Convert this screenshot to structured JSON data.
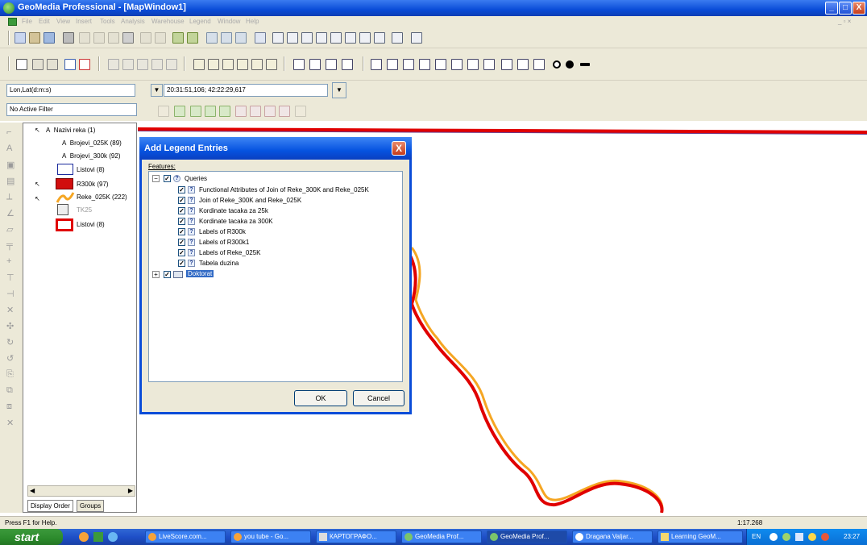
{
  "window": {
    "title": "GeoMedia Professional - [MapWindow1]",
    "minimize": "_",
    "maximize": "□",
    "close": "X",
    "restore_mini": "_ ▫ ×"
  },
  "menu": [
    "File",
    "Edit",
    "View",
    "Insert",
    "Tools",
    "Analysis",
    "Warehouse",
    "Legend",
    "Window",
    "Help"
  ],
  "coords": {
    "system_value": "Lon,Lat(d:m:s)",
    "readout_value": "20:31:51,106; 42:22:29,617"
  },
  "filter": {
    "value": "No Active Filter"
  },
  "legend": {
    "items": [
      {
        "label": "Nazivi reka (1)",
        "glyph": "A"
      },
      {
        "label": "Brojevi_025K (89)",
        "glyph": "A"
      },
      {
        "label": "Brojevi_300k (92)",
        "glyph": "A"
      },
      {
        "label": "Listovi (8)"
      },
      {
        "label": "R300k (97)"
      },
      {
        "label": "Reke_025K (222)"
      },
      {
        "label": "TK25"
      },
      {
        "label": "Listovi (8)"
      }
    ],
    "tabs": [
      "Display Order",
      "Groups"
    ]
  },
  "dialog": {
    "title": "Add Legend Entries",
    "features_label": "Features:",
    "root": {
      "label": "Queries",
      "expander": "−",
      "check": "✓",
      "icon": "?"
    },
    "queries": [
      "Functional Attributes of Join of Reke_300K and Reke_025K",
      "Join of Reke_300K and Reke_025K",
      "Kordinate tacaka za 25k",
      "Kordinate tacaka za 300K",
      "Labels of R300k",
      "Labels of R300k1",
      "Labels of Reke_025K",
      "Tabela duzina"
    ],
    "query_icon": "?",
    "check": "✓",
    "second_root": {
      "label": "Doktorat",
      "expander": "+",
      "check": "✓"
    },
    "ok": "OK",
    "cancel": "Cancel",
    "close": "X"
  },
  "status": {
    "help": "Press F1 for Help.",
    "scale": "1:17.268"
  },
  "taskbar": {
    "start": "start",
    "tasks": [
      "LiveScore.com...",
      "you tube - Go...",
      "КАРТОГРАФО...",
      "GeoMedia Prof...",
      "GeoMedia Prof...",
      "Dragana Valjar...",
      "Learning GeoM..."
    ],
    "language": "EN",
    "time": "23:27"
  }
}
